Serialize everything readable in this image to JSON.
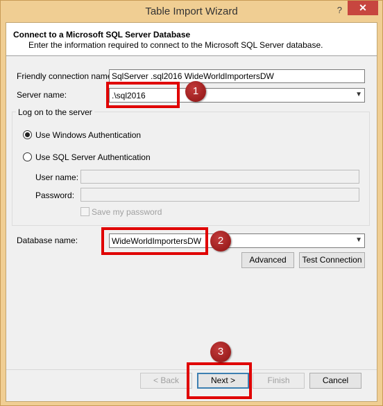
{
  "window": {
    "title": "Table Import Wizard",
    "help": "?",
    "close": "✕"
  },
  "header": {
    "title": "Connect to a Microsoft SQL Server Database",
    "subtitle": "Enter the information required to connect to the Microsoft SQL Server database."
  },
  "form": {
    "friendly_label": "Friendly connection name:",
    "friendly_value": "SqlServer .sql2016 WideWorldImportersDW",
    "server_label": "Server name:",
    "server_value": ".\\sql2016",
    "logon_group": "Log on to the server",
    "windows_auth": "Use Windows Authentication",
    "sql_auth": "Use SQL Server Authentication",
    "user_label": "User name:",
    "password_label": "Password:",
    "save_password": "Save my password",
    "db_label": "Database name:",
    "db_value": "WideWorldImportersDW"
  },
  "buttons": {
    "advanced": "Advanced",
    "test": "Test Connection",
    "back": "< Back",
    "next": "Next >",
    "finish": "Finish",
    "cancel": "Cancel"
  },
  "annotations": {
    "one": "1",
    "two": "2",
    "three": "3"
  },
  "colors": {
    "accent": "#e00000",
    "badge": "#a02020",
    "title_bar": "#f0ce93"
  }
}
